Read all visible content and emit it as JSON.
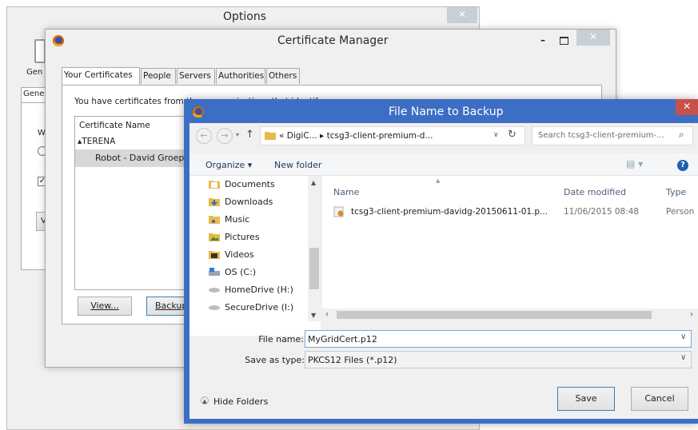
{
  "options": {
    "title": "Options",
    "tab_fragment": "Gen",
    "sub_tab_fragment": "Gene",
    "text_fragment": "Wh",
    "button_fragment": "Vi"
  },
  "cert_manager": {
    "title": "Certificate Manager",
    "tabs": [
      "Your Certificates",
      "People",
      "Servers",
      "Authorities",
      "Others"
    ],
    "intro_text": "You have certificates from these organizations that identify you:",
    "column_header": "Certificate Name",
    "tree_group": "▴TERENA",
    "tree_item": "Robot - David Groep",
    "view_button": "View...",
    "backup_button": "Backup..."
  },
  "file_dialog": {
    "title": "File Name to Backup",
    "breadcrumb": "« DigiC... ▸ tcsg3-client-premium-d...",
    "search_placeholder": "Search tcsg3-client-premium-...",
    "organize_label": "Organize ▾",
    "new_folder_label": "New folder",
    "nav_items": [
      {
        "label": "Documents",
        "icon": "documents-icon"
      },
      {
        "label": "Downloads",
        "icon": "downloads-icon"
      },
      {
        "label": "Music",
        "icon": "music-icon"
      },
      {
        "label": "Pictures",
        "icon": "pictures-icon"
      },
      {
        "label": "Videos",
        "icon": "videos-icon"
      },
      {
        "label": "OS (C:)",
        "icon": "drive-c-icon"
      },
      {
        "label": "HomeDrive (H:)",
        "icon": "network-drive-icon"
      },
      {
        "label": "SecureDrive (I:)",
        "icon": "network-drive-icon"
      }
    ],
    "columns": {
      "name": "Name",
      "date": "Date modified",
      "type": "Type"
    },
    "files": [
      {
        "name": "tcsg3-client-premium-davidg-20150611-01.p...",
        "date": "11/06/2015 08:48",
        "type": "Person"
      }
    ],
    "file_name_label": "File name:",
    "file_name_value": "MyGridCert.p12",
    "save_type_label": "Save as type:",
    "save_type_value": "PKCS12 Files (*.p12)",
    "hide_folders_label": "Hide Folders",
    "save_button": "Save",
    "cancel_button": "Cancel"
  },
  "colors": {
    "dialog_title_blue": "#3c6fc4",
    "close_red": "#c7504a",
    "window_bg": "#f0f0f0",
    "folder_yellow": "#e9b949"
  }
}
